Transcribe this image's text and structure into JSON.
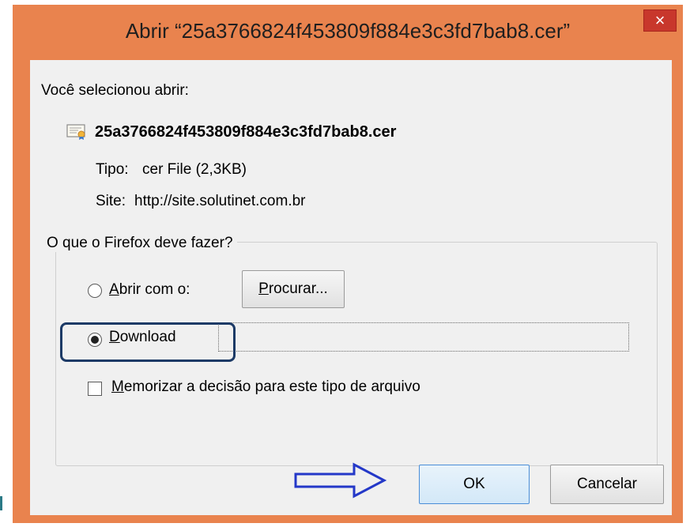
{
  "window": {
    "title": "Abrir “25a3766824f453809f884e3c3fd7bab8.cer”",
    "close_glyph": "×"
  },
  "intro": {
    "label": "Você selecionou abrir:",
    "file_name": "25a3766824f453809f884e3c3fd7bab8.cer",
    "file_icon": "certificate-file-icon",
    "type_label": "Tipo:",
    "type_value": "cer File (2,3KB)",
    "site_label": "Site:",
    "site_value": "http://site.solutinet.com.br"
  },
  "action_group": {
    "legend": "O que o Firefox deve fazer?",
    "open_with": {
      "label_underlined": "A",
      "label_rest": "brir com o:",
      "selected": false
    },
    "browse_button": {
      "label_underlined": "P",
      "label_rest": "rocurar..."
    },
    "download": {
      "label_underlined": "D",
      "label_rest": "ownload",
      "selected": true
    },
    "remember": {
      "label_underlined": "M",
      "label_rest": "emorizar a decisão para este tipo de arquivo",
      "checked": false
    }
  },
  "buttons": {
    "ok": "OK",
    "cancel": "Cancelar"
  },
  "colors": {
    "window_frame": "#e9834e",
    "close_button": "#c8372c",
    "client_background": "#f0f0f0",
    "annotation": "#1c3a66",
    "arrow": "#2438c8"
  }
}
